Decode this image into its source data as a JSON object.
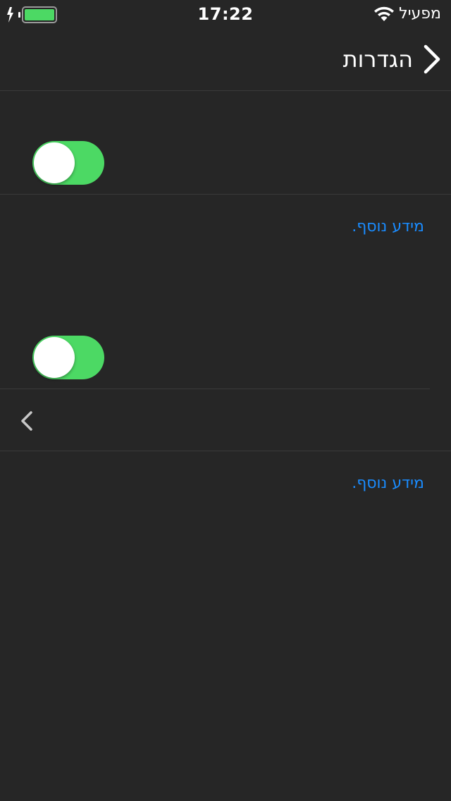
{
  "status_bar": {
    "time": "17:22",
    "carrier": "מפעיל",
    "battery_color": "#4cd964",
    "charging_icon": "bolt-icon",
    "wifi_icon": "wifi-icon"
  },
  "nav": {
    "title": "הגדרות",
    "back_icon": "chevron-right-icon"
  },
  "sections": [
    {
      "toggle_on": true,
      "info_link": "מידע נוסף."
    },
    {
      "toggle_on": true,
      "disclosure_icon": "chevron-left-icon",
      "info_link": "מידע נוסף."
    }
  ],
  "colors": {
    "background": "#262626",
    "accent_green": "#4cd964",
    "link_blue": "#1a8cff",
    "separator": "#3a3a3a"
  }
}
